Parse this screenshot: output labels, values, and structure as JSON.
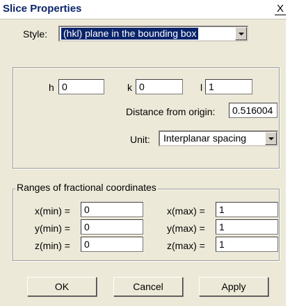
{
  "window": {
    "title": "Slice Properties",
    "close_glyph": "X"
  },
  "style": {
    "label": "Style:",
    "value": "(hkl) plane in the bounding box"
  },
  "plane": {
    "h_label": "h",
    "h_value": "0",
    "k_label": "k",
    "k_value": "0",
    "l_label": "l",
    "l_value": "1",
    "distance_label": "Distance from origin:",
    "distance_value": "0.516004",
    "unit_label": "Unit:",
    "unit_value": "Interplanar spacing"
  },
  "ranges": {
    "title": "Ranges of fractional coordinates",
    "xmin_label": "x(min) =",
    "xmin_value": "0",
    "xmax_label": "x(max) =",
    "xmax_value": "1",
    "ymin_label": "y(min) =",
    "ymin_value": "0",
    "ymax_label": "y(max) =",
    "ymax_value": "1",
    "zmin_label": "z(min) =",
    "zmin_value": "0",
    "zmax_label": "z(max) =",
    "zmax_value": "1"
  },
  "buttons": {
    "ok": "OK",
    "cancel": "Cancel",
    "apply": "Apply"
  }
}
